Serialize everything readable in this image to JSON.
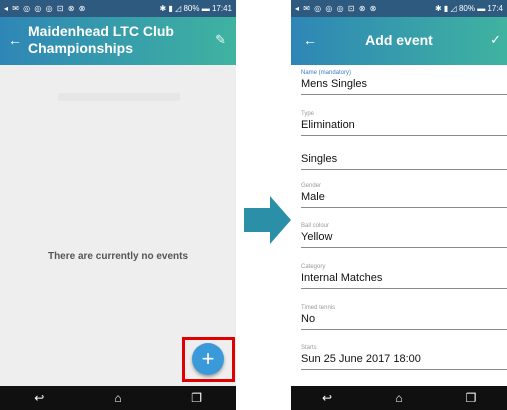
{
  "left_phone": {
    "status_time": "17:41",
    "status_battery": "80%",
    "status_icons": "◂ ✉ ◎ ◎ ◎ ⊡ ⊗ ⊗",
    "status_signal": "✱ ▮ ◿",
    "app_title": "Maidenhead LTC Club Championships",
    "empty_message": "There are currently no events",
    "fab_label": "+"
  },
  "right_phone": {
    "status_icons": "◂ ✉ ◎ ◎ ◎ ⊡ ⊗ ⊗",
    "status_signal": "✱ ▮ ◿",
    "status_battery": "80%",
    "status_time": "17:4",
    "title": "Add event",
    "fields": {
      "name_label": "Name (mandatory)",
      "name_value": "Mens Singles",
      "type_label": "Type",
      "type_value": "Elimination",
      "format_value": "Singles",
      "gender_label": "Gender",
      "gender_value": "Male",
      "ball_label": "Ball colour",
      "ball_value": "Yellow",
      "category_label": "Category",
      "category_value": "Internal Matches",
      "timed_label": "Timed tennis",
      "timed_value": "No",
      "starts_label": "Starts",
      "starts_value": "Sun 25 June 2017 18:00"
    }
  },
  "icons": {
    "back": "arrow-left-icon",
    "edit": "pencil-icon",
    "check": "check-icon",
    "add": "plus-icon",
    "nav_back": "nav-back-icon",
    "nav_home": "nav-home-icon",
    "nav_recent": "nav-recent-icon"
  },
  "colors": {
    "status_bar": "#2e5a80",
    "appbar_start": "#2e86b6",
    "appbar_end": "#3fb3a0",
    "fab": "#3a9ad9",
    "highlight": "#e00000",
    "arrow": "#2b8fa8"
  }
}
